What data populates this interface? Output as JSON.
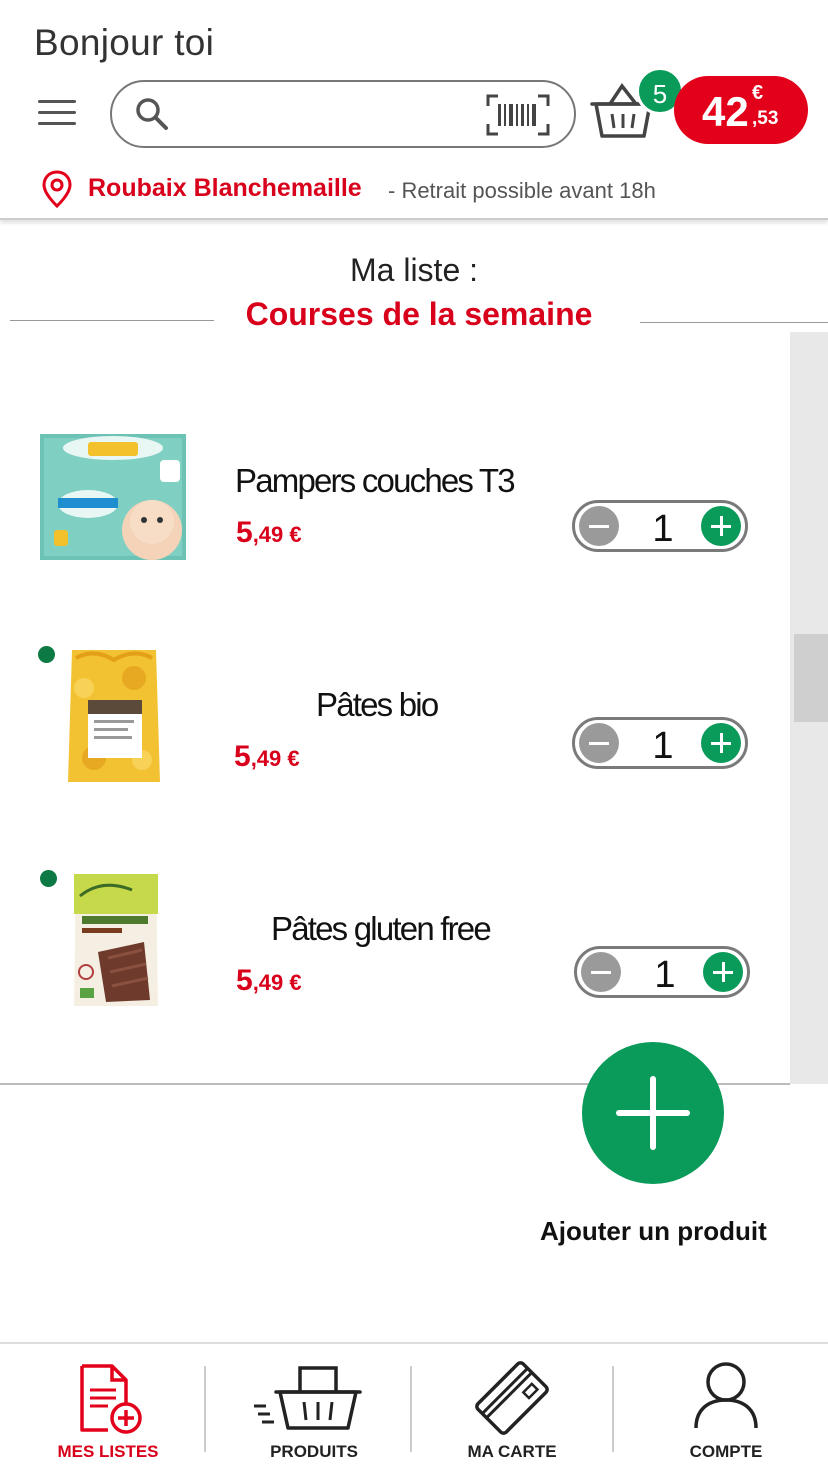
{
  "header": {
    "greeting": "Bonjour toi",
    "search_placeholder": "",
    "basket_count": "5",
    "cart_total_int": "42",
    "cart_total_cur": "€",
    "cart_total_dec": ",53"
  },
  "store": {
    "name": "Roubaix Blanchemaille",
    "pickup": "- Retrait possible avant 18h"
  },
  "list": {
    "label": "Ma liste :",
    "name": "Courses de la semaine"
  },
  "products": [
    {
      "name": "Pampers couches T3",
      "price_int": "5",
      "price_dec": ",49 €",
      "qty": "1"
    },
    {
      "name": "Pâtes bio",
      "price_int": "5",
      "price_dec": ",49 €",
      "qty": "1"
    },
    {
      "name": "Pâtes gluten free",
      "price_int": "5",
      "price_dec": ",49 €",
      "qty": "1"
    }
  ],
  "fab": {
    "label": "Ajouter un produit"
  },
  "nav": [
    {
      "label": "MES LISTES",
      "icon": "list-add-icon",
      "active": true
    },
    {
      "label": "PRODUITS",
      "icon": "basket-icon"
    },
    {
      "label": "MA CARTE",
      "icon": "card-icon"
    },
    {
      "label": "COMPTE",
      "icon": "user-icon"
    }
  ],
  "colors": {
    "brand_red": "#e2001a",
    "accent_green": "#0a9a5a"
  }
}
